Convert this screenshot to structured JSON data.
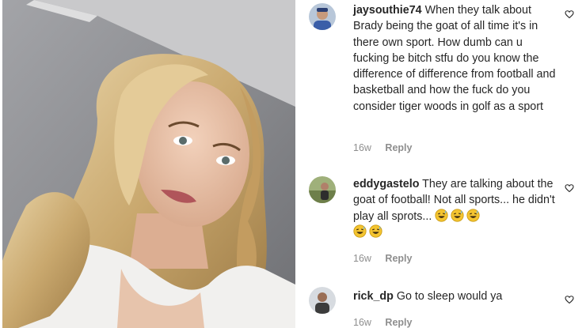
{
  "comments": [
    {
      "username": "jaysouthie74",
      "text": "When they talk about Brady being the goat of all time it's in there own sport. How dumb can u fucking be bitch stfu do you know the difference of difference from football and basketball and how the fuck do you consider tiger woods in golf as a sport",
      "time": "16w",
      "reply_label": "Reply"
    },
    {
      "username": "eddygastelo",
      "text": "They are talking about the goat of football! Not all sports... he didn't play all sprots...",
      "emojis": [
        "grinning-sweat-emoji",
        "grinning-sweat-emoji",
        "grinning-sweat-emoji",
        "grinning-sweat-emoji",
        "grinning-sweat-emoji"
      ],
      "time": "16w",
      "reply_label": "Reply"
    },
    {
      "username": "rick_dp",
      "text": "Go to sleep would ya",
      "time": "16w",
      "reply_label": "Reply"
    }
  ],
  "icons": {
    "like": "heart-outline-icon",
    "emoji": "grinning-sweat-emoji"
  },
  "colors": {
    "text": "#262626",
    "meta": "#8e8e8e",
    "emoji_face": "#f4c430"
  }
}
